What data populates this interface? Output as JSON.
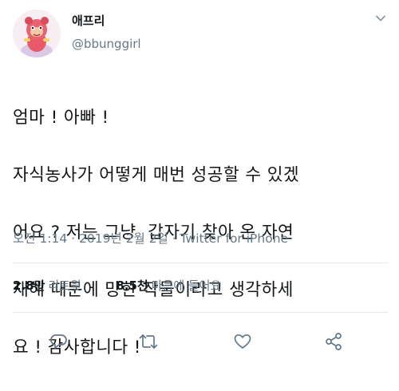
{
  "author": {
    "display_name": "애프리",
    "handle": "@bbunggirl",
    "avatar_icon": "cartoon-character-avatar"
  },
  "tweet": {
    "text_lines": [
      "엄마 ! 아빠 !",
      "자식농사가 어떻게 매번 성공할 수 있겠",
      "어요 ? 저는 그냥  갑자기 찾아 온 자연",
      "재해 때문에 망한 작물이라고 생각하세",
      "요 ! 감사합니다 !"
    ]
  },
  "meta": {
    "time_source": "오전 1:14 · 2019년 2월 2일 · Twitter for iPhone"
  },
  "stats": {
    "retweets_count": "2.8만",
    "retweets_label": "리트윗",
    "likes_count": "8.5천",
    "likes_label": "마음에 들어요"
  },
  "actions": {
    "reply_icon": "reply-icon",
    "retweet_icon": "retweet-icon",
    "like_icon": "heart-icon",
    "share_icon": "share-icon"
  },
  "colors": {
    "text": "#14171a",
    "secondary": "#657786",
    "divider": "#e1e8ed",
    "icon": "#657786"
  }
}
